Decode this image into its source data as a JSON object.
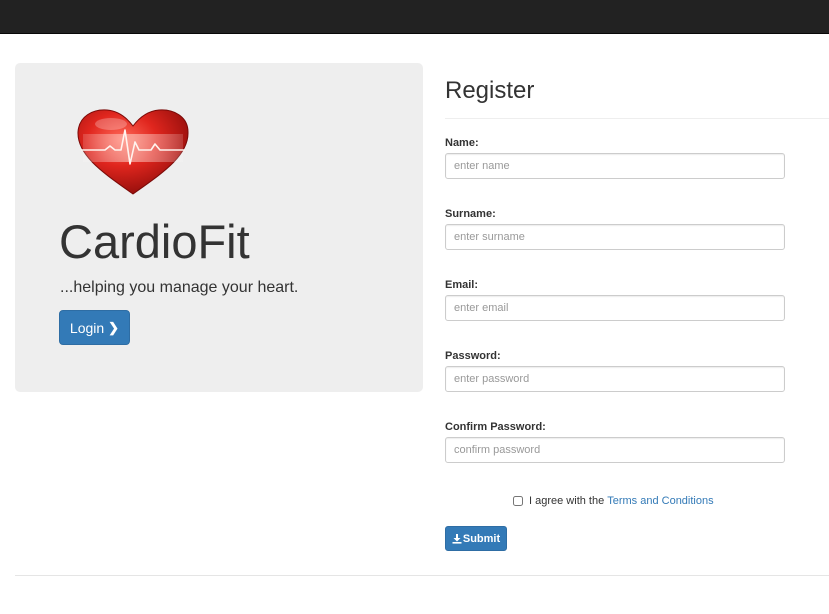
{
  "brand": {
    "title": "CardioFit",
    "tagline": "...helping you manage your heart.",
    "login_label": "Login",
    "login_icon": "chevron-right-icon",
    "logo_icon": "heart-ecg-logo"
  },
  "register": {
    "title": "Register",
    "fields": [
      {
        "label": "Name:",
        "placeholder": "enter name",
        "value": ""
      },
      {
        "label": "Surname:",
        "placeholder": "enter surname",
        "value": ""
      },
      {
        "label": "Email:",
        "placeholder": "enter email",
        "value": ""
      },
      {
        "label": "Password:",
        "placeholder": "enter password",
        "value": ""
      },
      {
        "label": "Confirm Password:",
        "placeholder": "confirm password",
        "value": ""
      }
    ],
    "agree_text": "I agree with the",
    "terms_link": "Terms and Conditions",
    "agree_checked": false,
    "submit_label": "Submit",
    "submit_icon": "download-icon"
  },
  "colors": {
    "navbar": "#222222",
    "panel": "#eeeeee",
    "primary": "#337ab7",
    "heart": "#d9231d"
  }
}
